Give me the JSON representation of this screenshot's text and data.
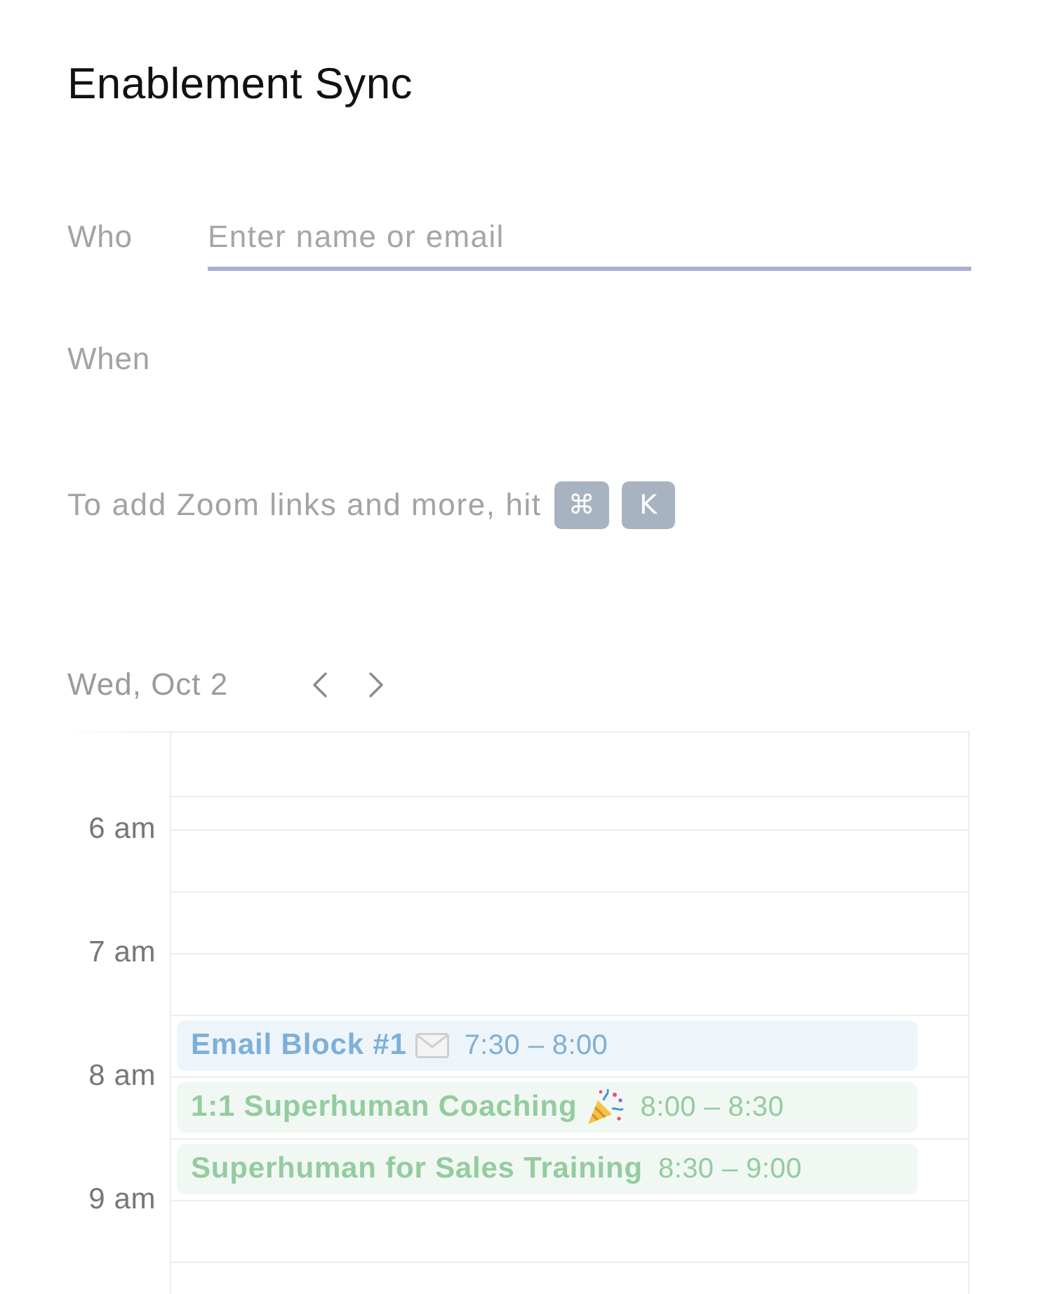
{
  "title": "Enablement Sync",
  "form": {
    "who": {
      "label": "Who",
      "placeholder": "Enter name or email"
    },
    "when": {
      "label": "When"
    }
  },
  "hint": {
    "text": "To add Zoom links and more, hit",
    "keys": [
      "⌘",
      "K"
    ]
  },
  "day": {
    "date": "Wed, Oct 2"
  },
  "calendar": {
    "hours": [
      {
        "label": "6 am"
      },
      {
        "label": "7 am",
        "second_half": {
          "title": "Email Block #1",
          "kind": "envelope",
          "time": "7:30 – 8:00",
          "color": "#7db0d9"
        }
      },
      {
        "label": "8 am",
        "first_half": {
          "title": "1:1 Superhuman Coaching",
          "kind": "party",
          "time": "8:00 – 8:30",
          "color": "#94cc9f"
        },
        "second_half": {
          "title": "Superhuman for Sales Training",
          "kind": "plain",
          "time": "8:30 – 9:00",
          "color": "#94cc9f"
        }
      },
      {
        "label": "9 am"
      }
    ]
  }
}
